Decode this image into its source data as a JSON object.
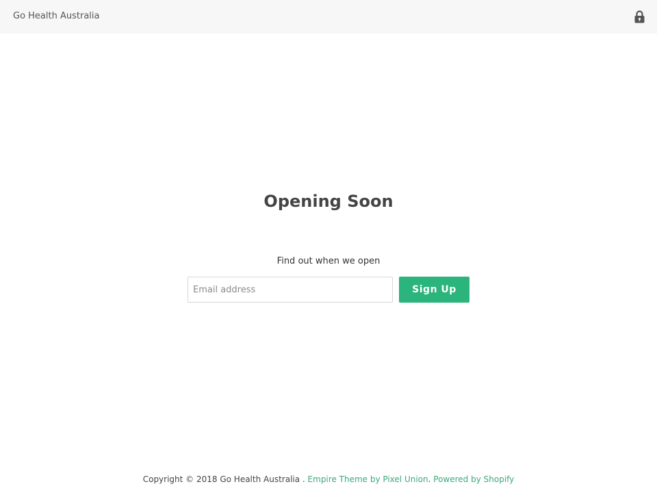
{
  "header": {
    "store_name": "Go Health Australia",
    "lock_icon": "lock-icon"
  },
  "main": {
    "title": "Opening Soon",
    "subtitle": "Find out when we open",
    "email_placeholder": "Email address",
    "email_value": "",
    "signup_label": "Sign Up"
  },
  "footer": {
    "copyright": "Copyright © 2018 Go Health Australia .",
    "theme_link": "Empire Theme by Pixel Union",
    "separator": ".",
    "powered_link": "Powered by Shopify"
  },
  "colors": {
    "accent": "#2bb47b",
    "link": "#3aa878",
    "header_bg": "#f7f7f7"
  }
}
